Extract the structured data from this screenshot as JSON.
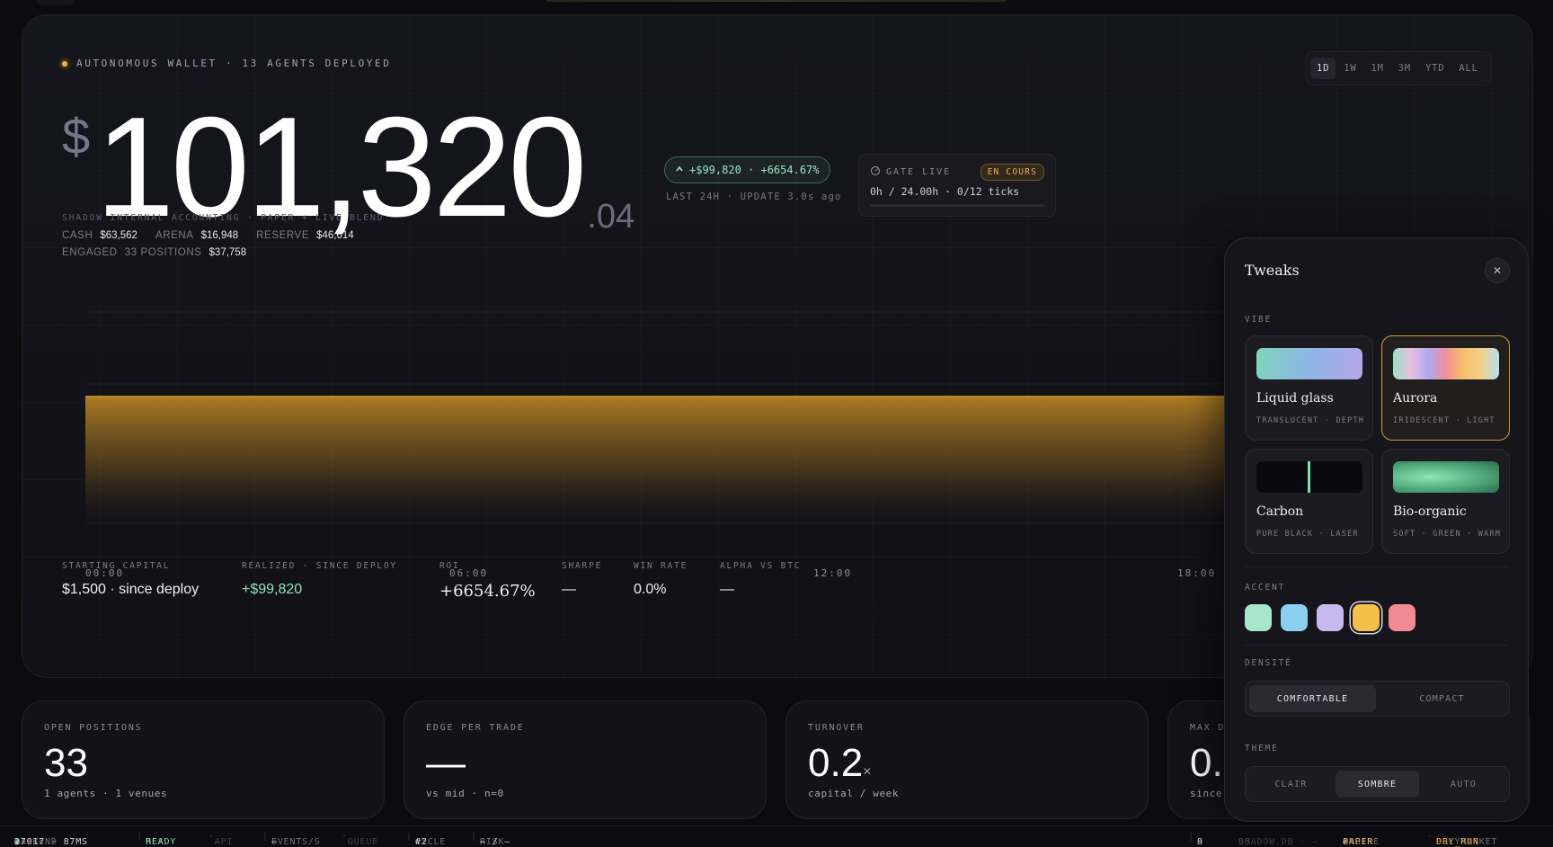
{
  "header": {
    "wallet_label": "AUTONOMOUS WALLET · 13 AGENTS DEPLOYED",
    "currency": "$",
    "amount_int": "101,320",
    "amount_dec": ".04",
    "delta_pill": "+$99,820 · +6654.67%",
    "delta_sub": "LAST 24H · UPDATE 3.0s ago",
    "accounting_label": "SHADOW INTERNAL ACCOUNTING · PAPER + LIVE BLEND",
    "cash_k": "CASH",
    "cash_v": "$63,562",
    "arena_k": "ARENA",
    "arena_v": "$16,948",
    "reserve_k": "RESERVE",
    "reserve_v": "$46,614",
    "engaged_k": "ENGAGED",
    "engaged_v1": "33 POSITIONS",
    "engaged_v2": "$37,758"
  },
  "gate": {
    "label": "GATE LIVE",
    "badge": "EN COURS",
    "progress": "0h / 24.00h · 0/12 ticks",
    "progress_fraction": 0.0
  },
  "range_tabs": [
    "1D",
    "1W",
    "1M",
    "3M",
    "YTD",
    "ALL"
  ],
  "range_active": "1D",
  "chart_data": {
    "type": "area",
    "x": [
      "00:00",
      "06:00",
      "12:00",
      "18:00"
    ],
    "series": [
      {
        "values": [
          101320.04,
          101320.04,
          101320.04,
          101320.04
        ]
      }
    ],
    "fill_color": "#d79a2a"
  },
  "stats": {
    "starting_k": "STARTING CAPITAL",
    "starting_v": "$1,500 · since deploy",
    "realized_k": "REALIZED · SINCE DEPLOY",
    "realized_v": "+$99,820",
    "roi_k": "ROI",
    "roi_v": "+6654.67%",
    "sharpe_k": "SHARPE",
    "sharpe_v": "—",
    "winrate_k": "WIN RATE",
    "winrate_v": "0.0%",
    "alpha_k": "ALPHA VS BTC",
    "alpha_v": "—"
  },
  "kpis": [
    {
      "label": "OPEN POSITIONS",
      "value": "33",
      "unit": "",
      "sub": "1 agents · 1 venues"
    },
    {
      "label": "EDGE PER TRADE",
      "value": "—",
      "unit": "",
      "sub": "vs mid · n=0"
    },
    {
      "label": "TURNOVER",
      "value": "0.2",
      "unit": "×",
      "sub": "capital / week"
    },
    {
      "label": "MAX D",
      "value": "0.",
      "unit": "",
      "sub": "since"
    }
  ],
  "tweaks": {
    "title": "Tweaks",
    "close": "✕",
    "vibe_label": "VIBE",
    "vibes": [
      {
        "name": "Liquid glass",
        "tag": "TRANSLUCENT · DEPTH"
      },
      {
        "name": "Aurora",
        "tag": "IRIDESCENT · LIGHT"
      },
      {
        "name": "Carbon",
        "tag": "PURE BLACK · LASER"
      },
      {
        "name": "Bio-organic",
        "tag": "SOFT · GREEN · WARM"
      }
    ],
    "vibe_active": "Aurora",
    "accent_label": "ACCENT",
    "accents": [
      "#a8e6cc",
      "#8ad0f0",
      "#c9b8f0",
      "#f4c04a",
      "#f28a94"
    ],
    "accent_active": "#f4c04a",
    "density_label": "DENSITÉ",
    "density_options": [
      "COMFORTABLE",
      "COMPACT"
    ],
    "density_active": "COMFORTABLE",
    "theme_label": "THEME",
    "theme_options": [
      "CLAIR",
      "SOMBRE",
      "AUTO"
    ],
    "theme_active": "SOMBRE"
  },
  "status_bar": {
    "backend_k": "BACKEND",
    "backend_v": "27017 · 87MS",
    "mlx_k": "MLX",
    "mlx_v": "READY",
    "api_k": "API",
    "api_v": "—",
    "events_k": "EVENTS/S",
    "events_v": "—",
    "queue_k": "QUEUE",
    "queue_v": "—",
    "cycle_k": "CYCLE",
    "cycle_v": "#2",
    "risk_k": "RISK",
    "risk_v": "— / —",
    "alerts_v": "0",
    "db_k": "DB",
    "db_v": "SHADOW.DB · —",
    "engine_k": "ENGINE",
    "engine_v": "PAPER",
    "polymarket_k": "POLYMARKET",
    "polymarket_v": "DRY_RUN"
  }
}
